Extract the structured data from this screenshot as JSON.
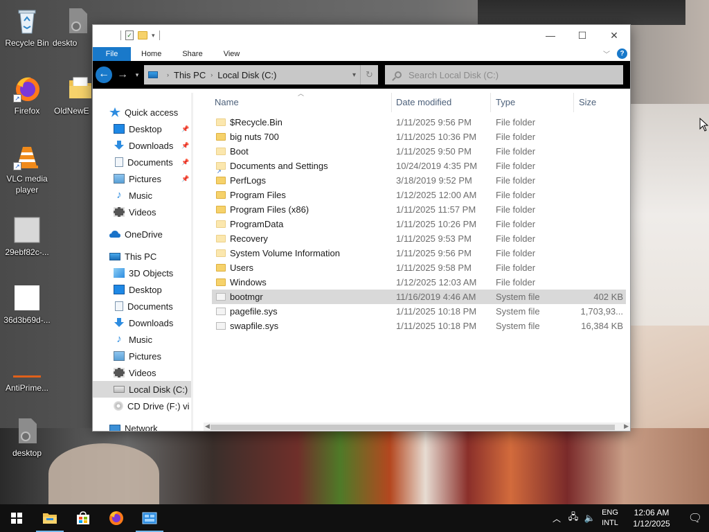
{
  "desktop": {
    "icons": [
      {
        "label": "Recycle Bin"
      },
      {
        "label": "deskto"
      },
      {
        "label": "Firefox"
      },
      {
        "label": "OldNewE"
      },
      {
        "label": "VLC media player"
      },
      {
        "label": "29ebf82c-..."
      },
      {
        "label": "36d3b69d-..."
      },
      {
        "label": "AntiPrime..."
      },
      {
        "label": "desktop"
      }
    ]
  },
  "window": {
    "ribbon_tabs": [
      "File",
      "Home",
      "Share",
      "View"
    ],
    "address": {
      "crumbs": [
        "This PC",
        "Local Disk (C:)"
      ]
    },
    "search_placeholder": "Search Local Disk (C:)",
    "nav": {
      "quick_access": "Quick access",
      "quick_items": [
        "Desktop",
        "Downloads",
        "Documents",
        "Pictures",
        "Music",
        "Videos"
      ],
      "onedrive": "OneDrive",
      "this_pc": "This PC",
      "pc_items": [
        "3D Objects",
        "Desktop",
        "Documents",
        "Downloads",
        "Music",
        "Pictures",
        "Videos",
        "Local Disk (C:)",
        "CD Drive (F:) vi"
      ],
      "network": "Network"
    },
    "columns": {
      "name": "Name",
      "date": "Date modified",
      "type": "Type",
      "size": "Size"
    },
    "files": [
      {
        "name": "$Recycle.Bin",
        "date": "1/11/2025 9:56 PM",
        "type": "File folder",
        "size": ""
      },
      {
        "name": "big nuts 700",
        "date": "1/11/2025 10:36 PM",
        "type": "File folder",
        "size": ""
      },
      {
        "name": "Boot",
        "date": "1/11/2025 9:50 PM",
        "type": "File folder",
        "size": ""
      },
      {
        "name": "Documents and Settings",
        "date": "10/24/2019 4:35 PM",
        "type": "File folder",
        "size": ""
      },
      {
        "name": "PerfLogs",
        "date": "3/18/2019 9:52 PM",
        "type": "File folder",
        "size": ""
      },
      {
        "name": "Program Files",
        "date": "1/12/2025 12:00 AM",
        "type": "File folder",
        "size": ""
      },
      {
        "name": "Program Files (x86)",
        "date": "1/11/2025 11:57 PM",
        "type": "File folder",
        "size": ""
      },
      {
        "name": "ProgramData",
        "date": "1/11/2025 10:26 PM",
        "type": "File folder",
        "size": ""
      },
      {
        "name": "Recovery",
        "date": "1/11/2025 9:53 PM",
        "type": "File folder",
        "size": ""
      },
      {
        "name": "System Volume Information",
        "date": "1/11/2025 9:56 PM",
        "type": "File folder",
        "size": ""
      },
      {
        "name": "Users",
        "date": "1/11/2025 9:58 PM",
        "type": "File folder",
        "size": ""
      },
      {
        "name": "Windows",
        "date": "1/12/2025 12:03 AM",
        "type": "File folder",
        "size": ""
      },
      {
        "name": "bootmgr",
        "date": "11/16/2019 4:46 AM",
        "type": "System file",
        "size": "402 KB"
      },
      {
        "name": "pagefile.sys",
        "date": "1/11/2025 10:18 PM",
        "type": "System file",
        "size": "1,703,93..."
      },
      {
        "name": "swapfile.sys",
        "date": "1/11/2025 10:18 PM",
        "type": "System file",
        "size": "16,384 KB"
      }
    ],
    "selected_file": "bootmgr"
  },
  "taskbar": {
    "lang_top": "ENG",
    "lang_bottom": "INTL",
    "time": "12:06 AM",
    "date": "1/12/2025"
  },
  "colors": {
    "accent": "#1979ca",
    "folder": "#f6d26b",
    "taskbar": "#101010"
  }
}
